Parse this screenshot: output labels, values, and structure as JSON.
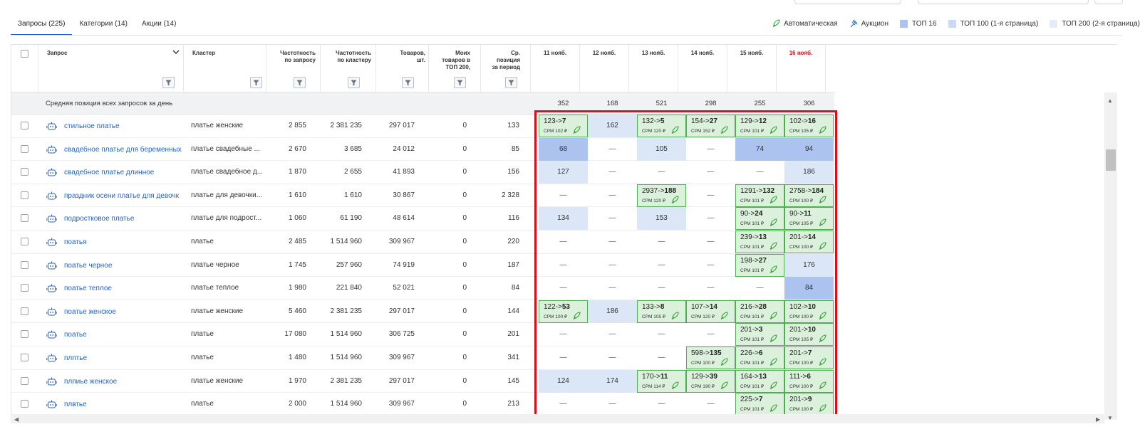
{
  "tabs": [
    {
      "label": "Запросы (225)",
      "active": true
    },
    {
      "label": "Категории (14)",
      "active": false
    },
    {
      "label": "Акции (14)",
      "active": false
    }
  ],
  "legend": {
    "auto": "Автоматическая",
    "auction": "Аукцион",
    "top16": "ТОП 16",
    "top100": "ТОП 100 (1-я страница)",
    "top200": "ТОП 200 (2-я страница)"
  },
  "colors": {
    "top16": "#abc3ee",
    "top100": "#c9daf5",
    "top200": "#e3ecf9",
    "green_cell": "#dcf1dc",
    "green_border": "#4fae4f",
    "red_box": "#e10c17",
    "link": "#2263c9",
    "today": "#e10c17"
  },
  "headers": {
    "query": "Запрос",
    "cluster": "Кластер",
    "freq_query": "Частотность\nпо запросу",
    "freq_cluster": "Частотность\nпо кластеру",
    "goods": "Товаров,\nшт.",
    "my_top200": "Моих\nтоваров в\nТОП 200,",
    "avg_pos": "Ср.\nпозиция\nза период",
    "dates": [
      "11 нояб.",
      "12 нояб.",
      "13 нояб.",
      "14 нояб.",
      "15 нояб.",
      "16 нояб."
    ]
  },
  "avg_row": {
    "label": "Средняя позиция всех запросов за день",
    "values": [
      "352",
      "168",
      "521",
      "298",
      "255",
      "306"
    ]
  },
  "rows": [
    {
      "query": "стильное платье",
      "cluster": "платье женские",
      "freq_q": "2 855",
      "freq_c": "2 381 235",
      "goods": "297 017",
      "my": "0",
      "avg": "133",
      "days": [
        {
          "t": "g",
          "from": "123",
          "to": "7",
          "cpm": "CPM 102 ₽"
        },
        {
          "t": "b2",
          "v": "162"
        },
        {
          "t": "g",
          "from": "132",
          "to": "5",
          "cpm": "CPM 120 ₽"
        },
        {
          "t": "g",
          "from": "154",
          "to": "27",
          "cpm": "CPM 152 ₽"
        },
        {
          "t": "g",
          "from": "129",
          "to": "12",
          "cpm": "CPM 101 ₽"
        },
        {
          "t": "g",
          "from": "102",
          "to": "16",
          "cpm": "CPM 105 ₽"
        }
      ]
    },
    {
      "query": "свадебное платье для беременных",
      "cluster": "платье свадебные ...",
      "freq_q": "2 670",
      "freq_c": "3 685",
      "goods": "24 012",
      "my": "0",
      "avg": "85",
      "days": [
        {
          "t": "b1",
          "v": "68"
        },
        {
          "t": "p",
          "v": "—"
        },
        {
          "t": "b2",
          "v": "105"
        },
        {
          "t": "p",
          "v": "—"
        },
        {
          "t": "b1",
          "v": "74"
        },
        {
          "t": "b1",
          "v": "94"
        }
      ]
    },
    {
      "query": "свадебное платье длинное",
      "cluster": "платье свадебное д...",
      "freq_q": "1 870",
      "freq_c": "2 655",
      "goods": "41 893",
      "my": "0",
      "avg": "156",
      "days": [
        {
          "t": "b2",
          "v": "127"
        },
        {
          "t": "p",
          "v": "—"
        },
        {
          "t": "p",
          "v": "—"
        },
        {
          "t": "p",
          "v": "—"
        },
        {
          "t": "p",
          "v": "—"
        },
        {
          "t": "b2",
          "v": "186"
        }
      ]
    },
    {
      "query": "праздник осени платье для девочк",
      "cluster": "платье для девочки...",
      "freq_q": "1 610",
      "freq_c": "1 610",
      "goods": "30 867",
      "my": "0",
      "avg": "2 328",
      "days": [
        {
          "t": "p",
          "v": "—"
        },
        {
          "t": "p",
          "v": "—"
        },
        {
          "t": "g",
          "from": "2937",
          "to": "188",
          "cpm": "CPM 120 ₽"
        },
        {
          "t": "p",
          "v": "—"
        },
        {
          "t": "g",
          "from": "1291",
          "to": "132",
          "cpm": "CPM 101 ₽"
        },
        {
          "t": "g",
          "from": "2758",
          "to": "184",
          "cpm": "CPM 100 ₽"
        }
      ]
    },
    {
      "query": "подростковое платье",
      "cluster": "платье для подрост...",
      "freq_q": "1 060",
      "freq_c": "61 190",
      "goods": "48 614",
      "my": "0",
      "avg": "116",
      "days": [
        {
          "t": "b2",
          "v": "134"
        },
        {
          "t": "p",
          "v": "—"
        },
        {
          "t": "b2",
          "v": "153"
        },
        {
          "t": "p",
          "v": "—"
        },
        {
          "t": "g",
          "from": "90",
          "to": "24",
          "cpm": "CPM 101 ₽"
        },
        {
          "t": "g",
          "from": "90",
          "to": "11",
          "cpm": "CPM 105 ₽"
        }
      ]
    },
    {
      "query": "поатья",
      "cluster": "платье",
      "freq_q": "2 485",
      "freq_c": "1 514 960",
      "goods": "309 967",
      "my": "0",
      "avg": "220",
      "days": [
        {
          "t": "p",
          "v": "—"
        },
        {
          "t": "p",
          "v": "—"
        },
        {
          "t": "p",
          "v": "—"
        },
        {
          "t": "p",
          "v": "—"
        },
        {
          "t": "g",
          "from": "239",
          "to": "13",
          "cpm": "CPM 101 ₽"
        },
        {
          "t": "g",
          "from": "201",
          "to": "14",
          "cpm": "CPM 100 ₽"
        }
      ]
    },
    {
      "query": "поатье черное",
      "cluster": "платье черное",
      "freq_q": "1 745",
      "freq_c": "257 960",
      "goods": "74 919",
      "my": "0",
      "avg": "187",
      "days": [
        {
          "t": "p",
          "v": "—"
        },
        {
          "t": "p",
          "v": "—"
        },
        {
          "t": "p",
          "v": "—"
        },
        {
          "t": "p",
          "v": "—"
        },
        {
          "t": "g",
          "from": "198",
          "to": "27",
          "cpm": "CPM 101 ₽"
        },
        {
          "t": "b2",
          "v": "176"
        }
      ]
    },
    {
      "query": "поатье теплое",
      "cluster": "платье теплое",
      "freq_q": "1 980",
      "freq_c": "221 840",
      "goods": "52 021",
      "my": "0",
      "avg": "84",
      "days": [
        {
          "t": "p",
          "v": "—"
        },
        {
          "t": "p",
          "v": "—"
        },
        {
          "t": "p",
          "v": "—"
        },
        {
          "t": "p",
          "v": "—"
        },
        {
          "t": "p",
          "v": "—"
        },
        {
          "t": "b1",
          "v": "84"
        }
      ]
    },
    {
      "query": "поатье женское",
      "cluster": "платье женские",
      "freq_q": "5 460",
      "freq_c": "2 381 235",
      "goods": "297 017",
      "my": "0",
      "avg": "144",
      "days": [
        {
          "t": "g",
          "from": "122",
          "to": "53",
          "cpm": "CPM 100 ₽"
        },
        {
          "t": "b2",
          "v": "186"
        },
        {
          "t": "g",
          "from": "133",
          "to": "8",
          "cpm": "CPM 105 ₽"
        },
        {
          "t": "g",
          "from": "107",
          "to": "14",
          "cpm": "CPM 120 ₽"
        },
        {
          "t": "g",
          "from": "216",
          "to": "28",
          "cpm": "CPM 101 ₽"
        },
        {
          "t": "g",
          "from": "102",
          "to": "10",
          "cpm": "CPM 100 ₽"
        }
      ]
    },
    {
      "query": "поатье",
      "cluster": "платье",
      "freq_q": "17 080",
      "freq_c": "1 514 960",
      "goods": "306 725",
      "my": "0",
      "avg": "201",
      "days": [
        {
          "t": "p",
          "v": "—"
        },
        {
          "t": "p",
          "v": "—"
        },
        {
          "t": "p",
          "v": "—"
        },
        {
          "t": "p",
          "v": "—"
        },
        {
          "t": "g",
          "from": "201",
          "to": "3",
          "cpm": "CPM 101 ₽"
        },
        {
          "t": "g",
          "from": "201",
          "to": "10",
          "cpm": "CPM 105 ₽"
        }
      ]
    },
    {
      "query": "плптье",
      "cluster": "платье",
      "freq_q": "1 480",
      "freq_c": "1 514 960",
      "goods": "309 967",
      "my": "0",
      "avg": "341",
      "days": [
        {
          "t": "p",
          "v": "—"
        },
        {
          "t": "p",
          "v": "—"
        },
        {
          "t": "p",
          "v": "—"
        },
        {
          "t": "g",
          "from": "598",
          "to": "135",
          "cpm": "CPM 100 ₽"
        },
        {
          "t": "g",
          "from": "226",
          "to": "6",
          "cpm": "CPM 101 ₽"
        },
        {
          "t": "g",
          "from": "201",
          "to": "7",
          "cpm": "CPM 100 ₽"
        }
      ]
    },
    {
      "query": "плпиье женское",
      "cluster": "платье женские",
      "freq_q": "1 970",
      "freq_c": "2 381 235",
      "goods": "297 017",
      "my": "0",
      "avg": "145",
      "days": [
        {
          "t": "b2",
          "v": "124"
        },
        {
          "t": "b2",
          "v": "174"
        },
        {
          "t": "g",
          "from": "170",
          "to": "11",
          "cpm": "CPM 114 ₽"
        },
        {
          "t": "g",
          "from": "129",
          "to": "39",
          "cpm": "CPM 190 ₽"
        },
        {
          "t": "g",
          "from": "164",
          "to": "13",
          "cpm": "CPM 101 ₽"
        },
        {
          "t": "g",
          "from": "111",
          "to": "6",
          "cpm": "CPM 100 ₽"
        }
      ]
    },
    {
      "query": "плвтье",
      "cluster": "платье",
      "freq_q": "2 000",
      "freq_c": "1 514 960",
      "goods": "309 967",
      "my": "0",
      "avg": "213",
      "days": [
        {
          "t": "p",
          "v": "—"
        },
        {
          "t": "p",
          "v": "—"
        },
        {
          "t": "p",
          "v": "—"
        },
        {
          "t": "p",
          "v": "—"
        },
        {
          "t": "g",
          "from": "225",
          "to": "7",
          "cpm": "CPM 101 ₽"
        },
        {
          "t": "g",
          "from": "201",
          "to": "9",
          "cpm": "CPM 100 ₽"
        }
      ]
    }
  ]
}
